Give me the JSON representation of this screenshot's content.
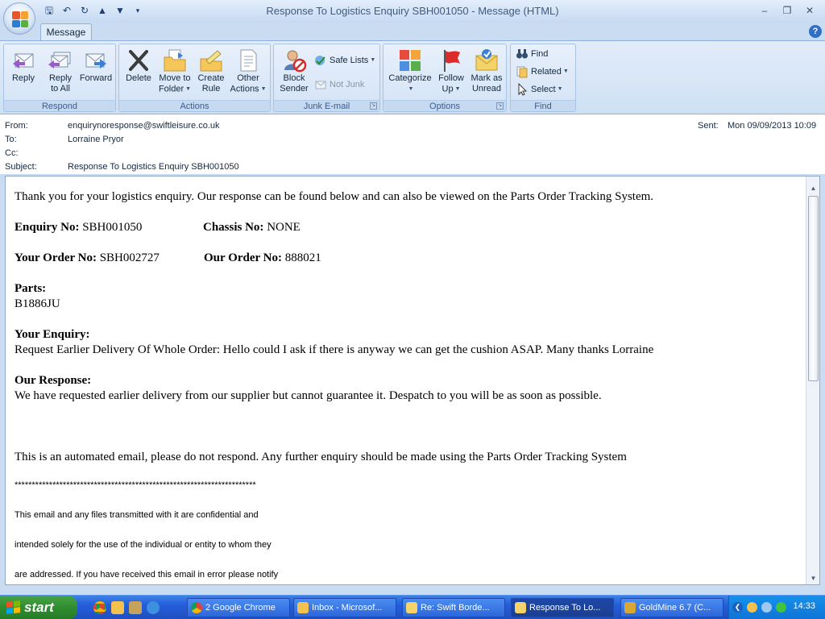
{
  "window": {
    "title": "Response To Logistics Enquiry SBH001050 - Message (HTML)"
  },
  "ribbon": {
    "tab": "Message",
    "groups": {
      "respond": {
        "label": "Respond",
        "reply": "Reply",
        "reply_all_1": "Reply",
        "reply_all_2": "to All",
        "forward": "Forward"
      },
      "actions": {
        "label": "Actions",
        "delete": "Delete",
        "move_1": "Move to",
        "move_2": "Folder",
        "create_1": "Create",
        "create_2": "Rule",
        "other_1": "Other",
        "other_2": "Actions"
      },
      "junk": {
        "label": "Junk E-mail",
        "block_1": "Block",
        "block_2": "Sender",
        "safe_lists": "Safe Lists",
        "not_junk": "Not Junk"
      },
      "options": {
        "label": "Options",
        "categorize": "Categorize",
        "follow_1": "Follow",
        "follow_2": "Up",
        "mark_1": "Mark as",
        "mark_2": "Unread"
      },
      "find": {
        "label": "Find",
        "find": "Find",
        "related": "Related",
        "select": "Select"
      }
    }
  },
  "headers": {
    "from_label": "From:",
    "from": "enquirynoresponse@swiftleisure.co.uk",
    "to_label": "To:",
    "to": "Lorraine Pryor",
    "cc_label": "Cc:",
    "cc": "",
    "subject_label": "Subject:",
    "subject": "Response To Logistics Enquiry SBH001050",
    "sent_label": "Sent:",
    "sent": "Mon 09/09/2013 10:09"
  },
  "body": {
    "intro": "Thank you for your logistics enquiry. Our response can be found below and can also be viewed on the Parts Order Tracking System.",
    "enquiry_no_label": "Enquiry No:",
    "enquiry_no": " SBH001050",
    "chassis_no_label": "Chassis No:",
    "chassis_no": " NONE",
    "your_order_label": "Your Order No:",
    "your_order": " SBH002727",
    "our_order_label": "Our Order No:",
    "our_order": " 888021",
    "parts_label": "Parts:",
    "parts": "B1886JU",
    "enquiry_label": "Your Enquiry:",
    "enquiry": "Request Earlier Delivery Of Whole Order: Hello could I ask if there is anyway we can get the cushion ASAP. Many thanks Lorraine",
    "response_label": "Our Response:",
    "response": "We have requested earlier delivery from our supplier but cannot guarantee it. Despatch to you will be as soon as possible.",
    "automated": "This is an automated email, please do not respond. Any further enquiry should be made using the Parts Order Tracking System",
    "stars": "**********************************************************************",
    "disclaimer_1": "This email and any files transmitted with it are confidential and",
    "disclaimer_2": "intended solely for the use of the individual or entity to whom they",
    "disclaimer_3": "are addressed. If you have received this email in error please notify"
  },
  "taskbar": {
    "start": "start",
    "tasks": [
      "2 Google Chrome",
      "Inbox - Microsof...",
      "Re: Swift Borde...",
      "Response To Lo...",
      "GoldMine 6.7 (C..."
    ],
    "clock": "14:33"
  }
}
